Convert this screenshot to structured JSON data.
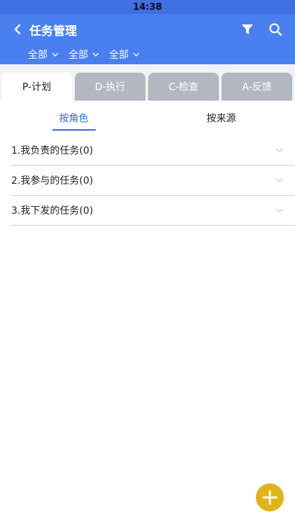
{
  "status_bar": {
    "time": "14:38"
  },
  "header": {
    "title": "任务管理",
    "filters": [
      {
        "label": "全部"
      },
      {
        "label": "全部"
      },
      {
        "label": "全部"
      }
    ]
  },
  "tabs": [
    {
      "label": "P-计划",
      "active": true
    },
    {
      "label": "D-执行",
      "active": false
    },
    {
      "label": "C-检查",
      "active": false
    },
    {
      "label": "A-反馈",
      "active": false
    }
  ],
  "subtabs": [
    {
      "label": "按角色",
      "active": true
    },
    {
      "label": "按来源",
      "active": false
    }
  ],
  "list": [
    {
      "label": "1.我负责的任务(0)"
    },
    {
      "label": "2.我参与的任务(0)"
    },
    {
      "label": "3.我下发的任务(0)"
    }
  ],
  "colors": {
    "header_blue": "#4a7ff0",
    "accent_blue": "#3a68d8",
    "fab_yellow": "#e2b21a",
    "tab_gray": "#b3b7bf"
  }
}
